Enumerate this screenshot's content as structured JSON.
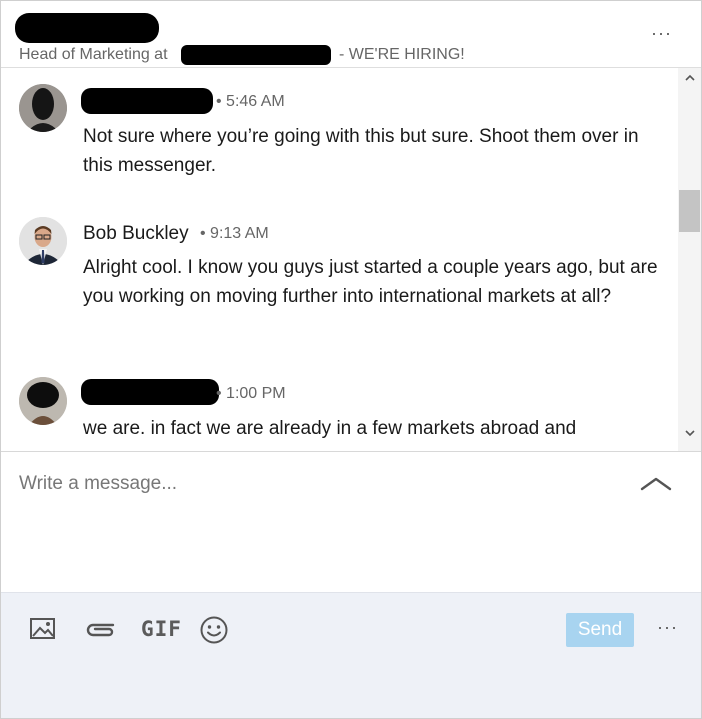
{
  "header": {
    "subtitle_prefix": "Head of Marketing at",
    "subtitle_suffix": "- WE'RE HIRING!",
    "more_label": "···"
  },
  "messages": [
    {
      "author": "",
      "time": "• 5:46 AM",
      "text": "Not sure where you’re going with this but sure. Shoot them over in this messenger."
    },
    {
      "author": "Bob Buckley",
      "time": "• 9:13 AM",
      "text": "Alright cool. I know you guys just started a couple years ago, but are you working on moving further into international markets at all?"
    },
    {
      "author": "",
      "time": "• 1:00 PM",
      "text": "we are. in fact we are already in a few markets abroad and"
    }
  ],
  "composer": {
    "placeholder": "Write a message..."
  },
  "toolbar": {
    "gif_label": "GIF",
    "send_label": "Send",
    "more_label": "···"
  },
  "colors": {
    "send_disabled": "#a8d4f0",
    "toolbar_bg": "#eef1f7"
  }
}
